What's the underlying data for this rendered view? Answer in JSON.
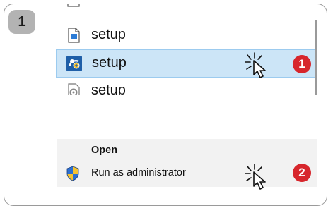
{
  "step": {
    "number": "1"
  },
  "explorer": {
    "items": [
      {
        "label": "setup",
        "icon": "document-icon"
      },
      {
        "label": "setup",
        "icon": "setup-installer-icon",
        "selected": true
      },
      {
        "label": "setup",
        "icon": "settings-file-icon"
      }
    ]
  },
  "context_menu": {
    "items": [
      {
        "label": "Open",
        "bold": true
      },
      {
        "label": "Run as administrator",
        "icon": "uac-shield-icon"
      }
    ]
  },
  "annotations": [
    {
      "number": "1",
      "color": "#d7262c"
    },
    {
      "number": "2",
      "color": "#d7262c"
    }
  ],
  "colors": {
    "selection": "#cce5f7",
    "selection_border": "#9ccbef",
    "badge_red": "#d7262c",
    "step_badge": "#b3b3b3"
  }
}
